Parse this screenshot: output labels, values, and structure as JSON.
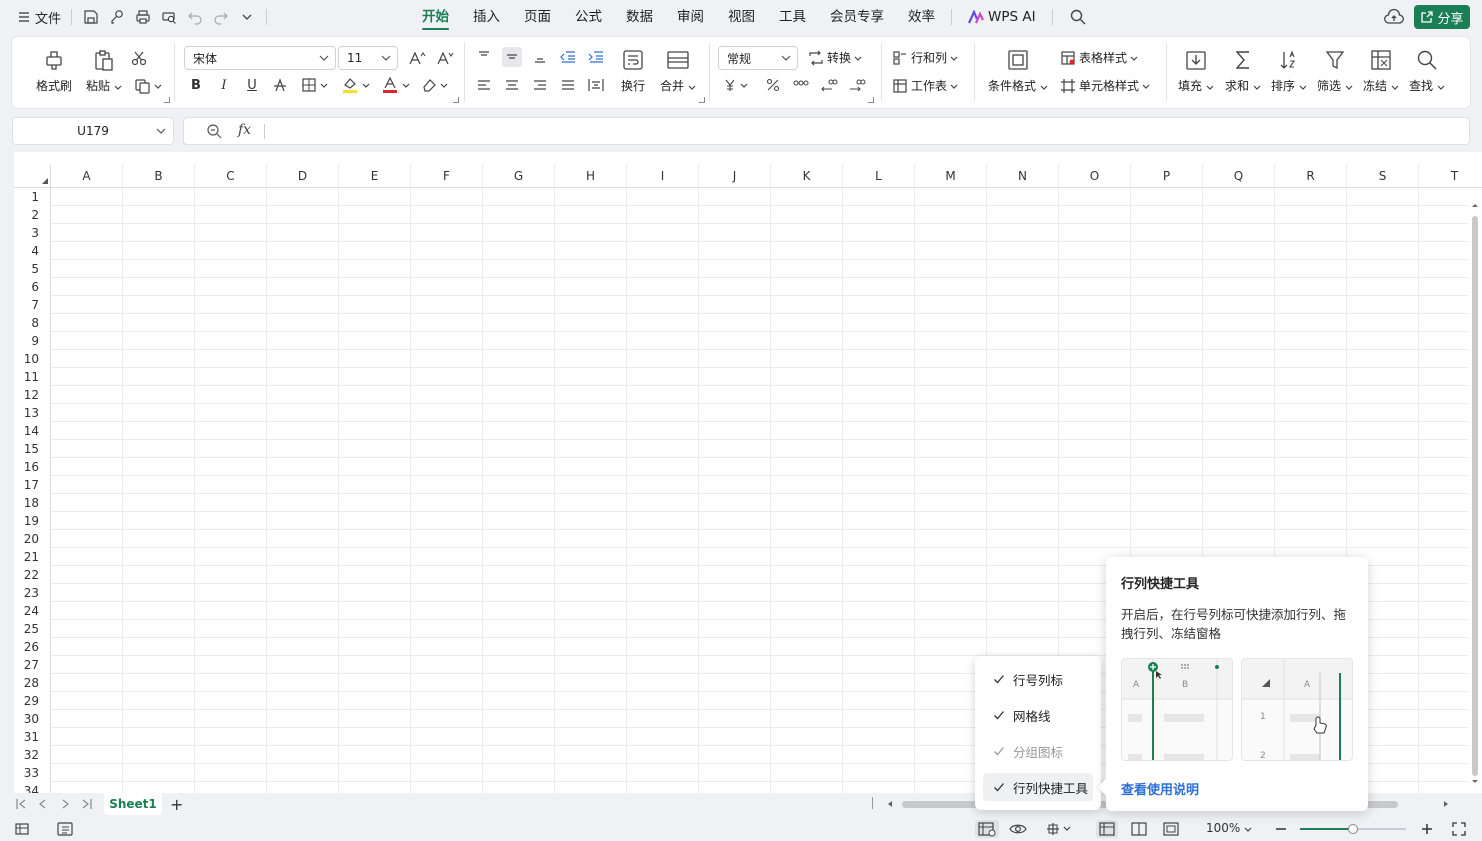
{
  "topbar": {
    "file_label": "文件",
    "tabs": [
      "开始",
      "插入",
      "页面",
      "公式",
      "数据",
      "审阅",
      "视图",
      "工具",
      "会员专享",
      "效率"
    ],
    "ai_label": "WPS AI",
    "share_label": "分享"
  },
  "ribbon": {
    "format_painter": "格式刷",
    "paste": "粘贴",
    "font_name": "宋体",
    "font_size": "11",
    "wrap": "换行",
    "merge": "合并",
    "number_format": "常规",
    "convert": "转换",
    "rows_cols": "行和列",
    "worksheet": "工作表",
    "cond_format": "条件格式",
    "table_style": "表格样式",
    "cell_style": "单元格样式",
    "fill": "填充",
    "sum": "求和",
    "sort": "排序",
    "filter": "筛选",
    "freeze": "冻结",
    "find": "查找",
    "bold": "B",
    "italic": "I",
    "underline": "U"
  },
  "formula_bar": {
    "name_box": "U179",
    "fx": "fx",
    "content": ""
  },
  "grid": {
    "columns": [
      "A",
      "B",
      "C",
      "D",
      "E",
      "F",
      "G",
      "H",
      "I",
      "J",
      "K",
      "L",
      "M",
      "N",
      "O",
      "P",
      "Q",
      "R",
      "S",
      "T"
    ],
    "rows": [
      "1",
      "2",
      "3",
      "4",
      "5",
      "6",
      "7",
      "8",
      "9",
      "10",
      "11",
      "12",
      "13",
      "14",
      "15",
      "16",
      "17",
      "18",
      "19",
      "20",
      "21",
      "22",
      "23",
      "24",
      "25",
      "26",
      "27",
      "28",
      "29",
      "30",
      "31",
      "32",
      "33",
      "34"
    ]
  },
  "sheets": {
    "active": "Sheet1",
    "add": "+"
  },
  "status": {
    "zoom": "100%",
    "zoom_fraction": 0.5
  },
  "view_menu": {
    "items": [
      {
        "label": "行号列标",
        "checked": true,
        "disabled": false
      },
      {
        "label": "网格线",
        "checked": true,
        "disabled": false
      },
      {
        "label": "分组图标",
        "checked": true,
        "disabled": true
      },
      {
        "label": "行列快捷工具",
        "checked": true,
        "disabled": false
      }
    ]
  },
  "tooltip": {
    "title": "行列快捷工具",
    "description": "开启后，在行号列标可快捷添加行列、拖拽行列、冻结窗格",
    "img1_col_a": "A",
    "img1_col_b": "B",
    "img2_col_a": "A",
    "img2_row1": "1",
    "img2_row2": "2",
    "link": "查看使用说明"
  },
  "colors": {
    "accent": "#1a7f54",
    "link": "#2f6fd6"
  }
}
